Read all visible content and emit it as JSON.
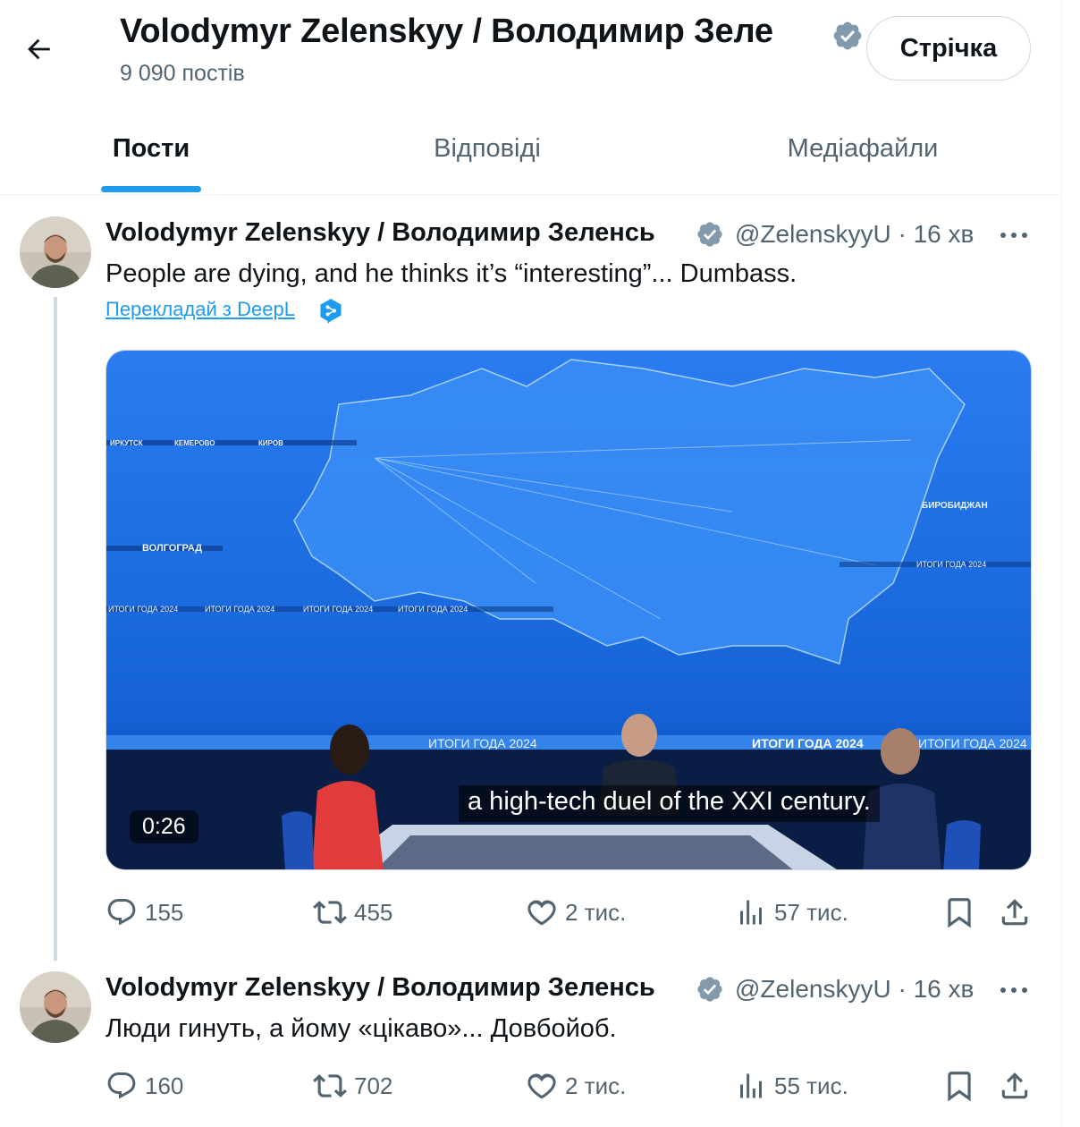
{
  "header": {
    "title": "Volodymyr Zelenskyy / Володимир Зеле",
    "posts_count": "9 090 постів",
    "feed_button": "Стрічка",
    "icons": [
      "arrow-left-icon",
      "verified-badge-icon"
    ]
  },
  "tabs": [
    {
      "label": "Пости",
      "active": true
    },
    {
      "label": "Відповіді",
      "active": false
    },
    {
      "label": "Медіафайли",
      "active": false
    }
  ],
  "tweets": [
    {
      "display_name": "Volodymyr Zelenskyy / Володимир Зеленсь",
      "handle_time": "@ZelenskyyU · 16 хв",
      "text": "People are dying, and he thinks it’s “interesting”... Dumbass.",
      "translate_link": "Перекладай з DeepL",
      "video": {
        "subtitle": "a high-tech duel of the XXI century.",
        "duration": "0:26",
        "banner_texts": [
          "ИТОГИ ГОДА 2024",
          "ВОЛГОГРАД",
          "КЕМЕРОВО",
          "ИРКУТСК",
          "КИРОВ",
          "БИРОБИДЖАН"
        ]
      },
      "stats": {
        "replies": "155",
        "reposts": "455",
        "likes": "2 тис.",
        "views": "57 тис."
      }
    },
    {
      "display_name": "Volodymyr Zelenskyy / Володимир Зеленсь",
      "handle_time": "@ZelenskyyU · 16 хв",
      "text": "Люди гинуть, а йому «цікаво»... Довбойоб.",
      "stats": {
        "replies": "160",
        "reposts": "702",
        "likes": "2 тис.",
        "views": "55 тис."
      }
    }
  ],
  "colors": {
    "accent": "#1d9bf0",
    "text": "#0f1419",
    "muted": "#536471",
    "border": "#cfd9de",
    "video_bg": "#1565d8"
  }
}
